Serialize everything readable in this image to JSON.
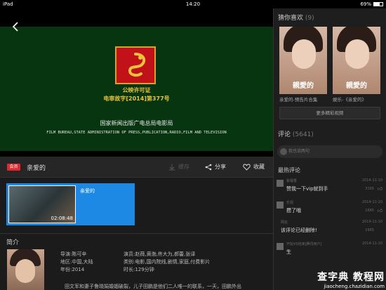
{
  "status_bar": {
    "device": "iPad",
    "time": "14:20",
    "battery": "69%",
    "battery_level": 0.69
  },
  "video": {
    "license_line1": "公映许可证",
    "license_line2": "电审故字[2014]第377号",
    "agency_cn": "国家新闻出版广电总局电影局",
    "agency_en": "FILM BUREAU,STATE ADMINISTRATION OF PRESS,PUBLICATION,RADIO,FILM AND TELEVISION"
  },
  "actionbar": {
    "vip_badge": "会员",
    "title": "亲爱的",
    "download": "缓存",
    "share": "分享",
    "favorite": "收藏"
  },
  "episode": {
    "title": "亲爱的",
    "duration": "02:08:48"
  },
  "intro": {
    "heading": "简介",
    "director": "导演:陈可辛",
    "region": "地区:中国,大陆",
    "year": "年份:2014",
    "cast": "演员:赵薇,黄渤,佟大为,郝蕾,张译",
    "genre": "类别:电影,国内院线,剧情,家庭,付费影片",
    "runtime": "时长:129分钟",
    "synopsis": "田文军和妻子鲁晓娟婚姻破裂，儿子田鹏是他们二人唯一的联系，一天，田鹏外出"
  },
  "side": {
    "recommend_heading": "猜你喜欢",
    "recommend_count": "(9)",
    "recs": [
      {
        "brand": "親愛的",
        "caption": "亲爱的-预告片合集"
      },
      {
        "brand": "親愛的",
        "caption": "娱乐-《亲爱的》"
      }
    ],
    "more_button": "更多精彩视频",
    "comments_heading": "评论",
    "comments_count": "(5641)",
    "comment_placeholder": "我也说两句",
    "hot_heading": "最热评论",
    "comments": [
      {
        "user": "紫檀香",
        "time": "2014-11-10",
        "text": "赞我一下vip就到手",
        "likes": "3165"
      },
      {
        "user": "乐观",
        "time": "2014-11-10",
        "text": "攒了哦",
        "likes": "1665"
      },
      {
        "user": "网友",
        "time": "2014-11-10",
        "text": "该评论已经删除!",
        "likes": "1665"
      },
      {
        "user": "开始VS结束[腾讯用户]",
        "time": "2014-11-10",
        "text": "生",
        "likes": ""
      }
    ]
  },
  "watermark": {
    "big": "查字典 教程网",
    "small": "jiaocheng.chazidian.com"
  }
}
